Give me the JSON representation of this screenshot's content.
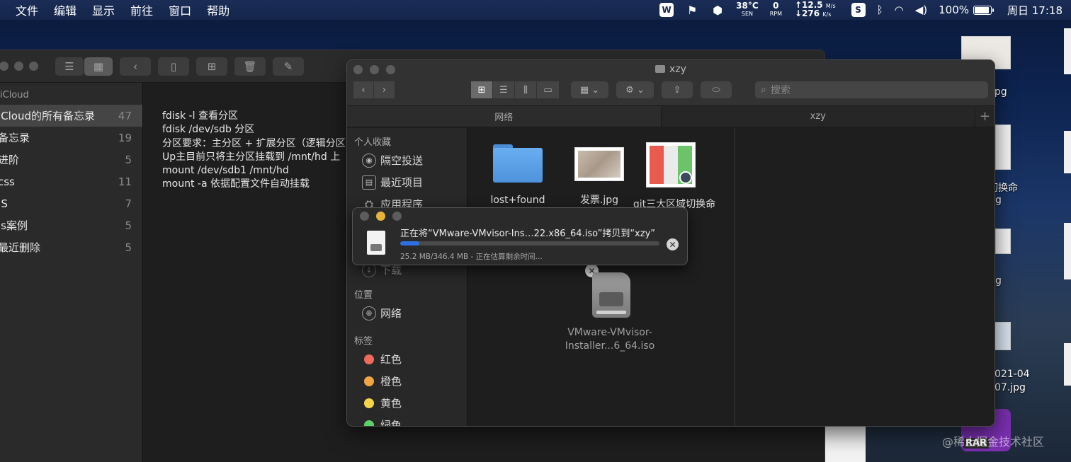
{
  "menubar": {
    "items": [
      "文件",
      "编辑",
      "显示",
      "前往",
      "窗口",
      "帮助"
    ],
    "temp": "38°C",
    "temp_sub": "SEN",
    "fan": "0",
    "fan_sub": "RPM",
    "net_up": "↑12.5",
    "net_up_unit": "M/s",
    "net_down": "↓276",
    "net_down_unit": "K/s",
    "battery": "100%",
    "clock": "周日 17:18"
  },
  "notes": {
    "section": "iCloud",
    "folders": [
      {
        "name": "iCloud的所有备忘录",
        "count": "47"
      },
      {
        "name": "备忘录",
        "count": "19"
      },
      {
        "name": "进阶",
        "count": "5"
      },
      {
        "name": "css",
        "count": "11"
      },
      {
        "name": "JS",
        "count": "7"
      },
      {
        "name": "js案例",
        "count": "5"
      },
      {
        "name": "最近删除",
        "count": "5"
      }
    ],
    "lines": [
      "fdisk -l 查看分区",
      "fdisk /dev/sdb 分区",
      "分区要求：主分区 + 扩展分区（逻辑分区",
      "Up主目前只将主分区挂载到 /mnt/hd 上",
      "mount  /dev/sdb1  /mnt/hd",
      "mount -a  依据配置文件自动挂载"
    ]
  },
  "finder": {
    "title": "xzy",
    "search_placeholder": "搜索",
    "tabs": [
      "网络",
      "xzy"
    ],
    "sidebar": {
      "favorites_title": "个人收藏",
      "favorites": [
        "隔空投送",
        "最近项目",
        "应用程序"
      ],
      "downloads": "下载",
      "locations_title": "位置",
      "network": "网络",
      "tags_title": "标签",
      "tags": [
        {
          "name": "红色",
          "color": "#ec6a5e"
        },
        {
          "name": "橙色",
          "color": "#f0a545"
        },
        {
          "name": "黄色",
          "color": "#f5d547"
        },
        {
          "name": "绿色",
          "color": "#5fd068"
        }
      ]
    },
    "files": {
      "folder": "lost+found",
      "invoice": "发票.jpg",
      "git": "git三大区域切换命",
      "iso_line1": "VMware-VMvisor-",
      "iso_line2": "Installer...6_64.iso"
    }
  },
  "copy_dialog": {
    "message": "正在将“VMware-VMvisor-Ins…22.x86_64.iso”拷贝到“xzy”",
    "status": "25.2 MB/346.4 MB - 正在估算剩余时间...",
    "progress": 0.073
  },
  "desktop": {
    "labels": [
      "jpg",
      "切换命",
      "g",
      "g",
      "021-04",
      "07.jpg"
    ],
    "rar": "RAR"
  },
  "watermark": "@稀土掘金技术社区"
}
